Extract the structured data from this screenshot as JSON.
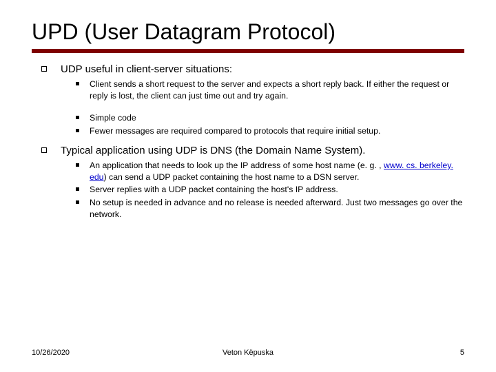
{
  "title": "UPD (User Datagram Protocol)",
  "sections": [
    {
      "heading": "UDP useful in client-server situations:",
      "items": [
        "Client sends a short request to the server and expects a short reply back. If either the request or reply is lost, the client can just time out and try again.",
        "Simple code",
        "Fewer messages are required compared to protocols that require initial setup."
      ]
    },
    {
      "heading": "Typical application using UDP is DNS (the Domain Name System).",
      "items": [
        {
          "pre": "An application that needs to look up the IP address of some host name (e. g. , ",
          "link_text": "www. cs. berkeley. edu",
          "post": ") can send a UDP packet containing the host name to a DSN server."
        },
        "Server replies with a UDP packet containing the host's IP address.",
        "No setup is needed in advance and no release is needed afterward. Just two messages go over the network."
      ]
    }
  ],
  "footer": {
    "date": "10/26/2020",
    "author": "Veton Këpuska",
    "page": "5"
  },
  "chart_data": {
    "type": "table",
    "note": "Presentation slide — no quantitative chart data present."
  }
}
